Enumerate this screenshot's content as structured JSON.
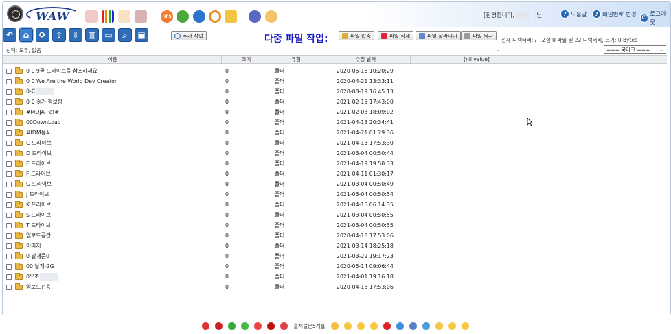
{
  "header": {
    "welcome_prefix": "[환영합니다,",
    "welcome_suffix": "님",
    "links": {
      "help": "도움말",
      "password": "비밀번호 변경",
      "logout": "로그아웃"
    },
    "icon_labels": {
      "hfs": "HFS"
    }
  },
  "toolbar": {
    "add_label": "추가 작업",
    "multi_title": "다중 파일 작업:",
    "archive_label": "파일 압축",
    "delete_label": "파일 삭제",
    "cut_label": "파일 잘라내기",
    "copy_label": "파일 복사"
  },
  "status": {
    "current_dir": "현재 디렉터리: /",
    "summary": "포함 0 파일 및 22 디렉터리, 크기: 0 Bytes",
    "selection": "선택: 모두, 없음",
    "dot": ".",
    "bookmark": "=== 북마크 ===",
    "bookmark_arrow": "⌄"
  },
  "table": {
    "headers": {
      "name": "이름",
      "size": "크기",
      "type": "유형",
      "modified": "수정 날자",
      "extra": "[nil value]"
    },
    "rows": [
      {
        "name": "0 0 9곧 드라이브를 참조하세요",
        "size": "0",
        "type": "폴더",
        "date": "2020-05-16 10:20:29"
      },
      {
        "name": "0 0 We Are the World Dev Creator",
        "size": "0",
        "type": "폴더",
        "date": "2020-04-21 13:33:11"
      },
      {
        "name": "0-C",
        "size": "0",
        "type": "폴더",
        "date": "2020-08-19 16:45:13",
        "masked": true
      },
      {
        "name": "0-0 ※가 정보함",
        "size": "0",
        "type": "폴더",
        "date": "2021-02-15 17:43:00"
      },
      {
        "name": "#MOJA-Paf#",
        "size": "0",
        "type": "폴더",
        "date": "2021-02-03 18:09:02"
      },
      {
        "name": "00DownLoad",
        "size": "0",
        "type": "폴더",
        "date": "2021-04-13 20:34:41"
      },
      {
        "name": "#IDM용#",
        "size": "0",
        "type": "폴더",
        "date": "2021-04-21 01:29:36"
      },
      {
        "name": "C 드라이브",
        "size": "0",
        "type": "폴더",
        "date": "2021-04-13 17:53:30"
      },
      {
        "name": "D 드라이브",
        "size": "0",
        "type": "폴더",
        "date": "2021-03-04 00:50:44"
      },
      {
        "name": "E 드라이브",
        "size": "0",
        "type": "폴더",
        "date": "2021-04-19 19:50:33"
      },
      {
        "name": "F 드라이브",
        "size": "0",
        "type": "폴더",
        "date": "2021-04-11 01:30:17"
      },
      {
        "name": "G 드라이브",
        "size": "0",
        "type": "폴더",
        "date": "2021-03-04 00:50:49"
      },
      {
        "name": "J 드라이브",
        "size": "0",
        "type": "폴더",
        "date": "2021-03-04 00:50:54"
      },
      {
        "name": "K 드라이브",
        "size": "0",
        "type": "폴더",
        "date": "2021-04-15 06:14:35"
      },
      {
        "name": "S 드라이브",
        "size": "0",
        "type": "폴더",
        "date": "2021-03-04 00:50:55"
      },
      {
        "name": "T 드라이브",
        "size": "0",
        "type": "폴더",
        "date": "2021-03-04 00:50:55"
      },
      {
        "name": "업로드공간",
        "size": "0",
        "type": "폴더",
        "date": "2020-04-18 17:53:06"
      },
      {
        "name": "이미지",
        "size": "0",
        "type": "폴더",
        "date": "2021-03-14 18:25:18"
      },
      {
        "name": "0 날개품0",
        "size": "0",
        "type": "폴더",
        "date": "2021-03-22 19:17:23"
      },
      {
        "name": "00 날개-2G",
        "size": "0",
        "type": "폴더",
        "date": "2020-05-14 09:06:44"
      },
      {
        "name": "0오조",
        "size": "0",
        "type": "폴더",
        "date": "2021-04-01 19:16:18",
        "masked": true
      },
      {
        "name": "업로드전용",
        "size": "0",
        "type": "폴더",
        "date": "2020-04-18 17:53:06"
      }
    ]
  },
  "footer": {
    "label": "출처불문5계홀"
  },
  "colors": {
    "accent_blue": "#2f6db8",
    "title_blue": "#1a1ac4",
    "folder_yellow": "#e8b84a"
  }
}
